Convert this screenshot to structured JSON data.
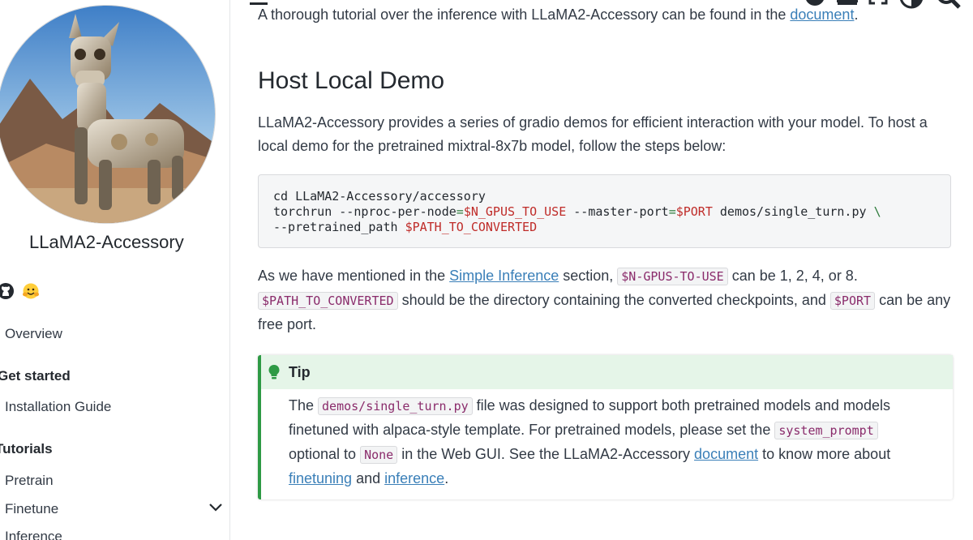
{
  "sidebar": {
    "site_name": "LLaMA2-Accessory",
    "icons": [
      "github-icon",
      "hugging-face-icon"
    ],
    "items": [
      {
        "label": "Overview",
        "type": "link"
      },
      {
        "label": "Get started",
        "type": "caption"
      },
      {
        "label": "Installation Guide",
        "type": "link"
      },
      {
        "label": "Tutorials",
        "type": "caption"
      },
      {
        "label": "Pretrain",
        "type": "link"
      },
      {
        "label": "Finetune",
        "type": "link"
      },
      {
        "label": "Inference",
        "type": "link"
      }
    ]
  },
  "header": {
    "icons": [
      "menu-icon",
      "github-icon",
      "download-icon",
      "fullscreen-icon",
      "theme-toggle-icon",
      "search-icon"
    ]
  },
  "content": {
    "intro_prefix": "A thorough tutorial over the inference with LLaMA2-Accessory can be found in the ",
    "intro_link": "document",
    "intro_suffix": ".",
    "heading": "Host Local Demo",
    "para1_line1": "LLaMA2-Accessory provides a series of gradio demos for efficient interaction with your model. To host a",
    "para1_line2": "local demo for the pretrained mixtral-8x7b model, follow the steps below:",
    "code": {
      "line1": "cd LLaMA2-Accessory/accessory",
      "l2_a": "torchrun --nproc-per-node",
      "l2_eq1": "=",
      "l2_var1": "$N_GPUS_TO_USE",
      "l2_b": " --master-port",
      "l2_eq2": "=",
      "l2_var2": "$PORT",
      "l2_c": " demos/single_turn.py ",
      "l2_bs": "\\",
      "l3_a": "--pretrained_path ",
      "l3_var": "$PATH_TO_CONVERTED"
    },
    "para2": {
      "t1": "As we have mentioned in the ",
      "link": "Simple Inference",
      "t2": " section, ",
      "code1": "$N-GPUS-TO-USE",
      "t3": " can be 1, 2, 4, or 8.",
      "code2": "$PATH_TO_CONVERTED",
      "t4": " should be the directory containing the converted checkpoints, and ",
      "code3": "$PORT",
      "t5": " can be any",
      "t6": "free port."
    },
    "tip": {
      "title": "Tip",
      "t1": "The ",
      "code1": "demos/single_turn.py",
      "t2": " file was designed to support both pretrained models and models",
      "t3": "finetuned with alpaca-style template. For pretrained models, please set the ",
      "code2": "system_prompt",
      "t4": "optional to ",
      "code3": "None",
      "t5": " in the Web GUI. See the LLaMA2-Accessory ",
      "link1": "document",
      "t6": " to know more about",
      "link2": "finetuning",
      "t7": " and ",
      "link3": "inference",
      "t8": "."
    }
  },
  "colors": {
    "accent_link": "#3a7fb8",
    "tip_green": "#2e9a45",
    "code_var": "#bf2b28"
  }
}
